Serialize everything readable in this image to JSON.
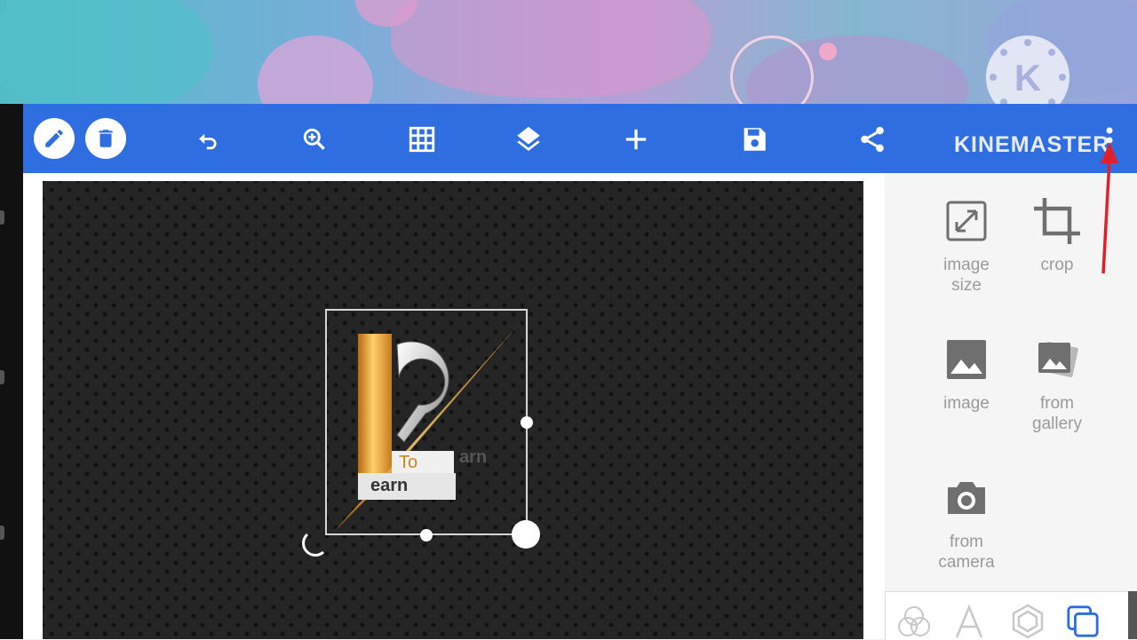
{
  "app": {
    "brand": "KINEMASTER"
  },
  "toolbar": {
    "items": [
      {
        "icon": "pencil-icon",
        "name": "edit"
      },
      {
        "icon": "trash-icon",
        "name": "delete"
      },
      {
        "icon": "undo-icon",
        "name": "undo"
      },
      {
        "icon": "zoom-in-icon",
        "name": "zoom"
      },
      {
        "icon": "grid-icon",
        "name": "grid"
      },
      {
        "icon": "layers-icon",
        "name": "layers"
      },
      {
        "icon": "plus-icon",
        "name": "add"
      },
      {
        "icon": "save-icon",
        "name": "save"
      },
      {
        "icon": "share-icon",
        "name": "share"
      },
      {
        "icon": "more-vertical-icon",
        "name": "more"
      }
    ]
  },
  "canvas": {
    "logo": {
      "letters": [
        "To",
        "arn",
        "earn"
      ]
    }
  },
  "side_panel": {
    "tools": [
      {
        "label_line1": "image",
        "label_line2": "size",
        "icon": "resize-icon"
      },
      {
        "label_line1": "crop",
        "label_line2": "",
        "icon": "crop-icon"
      },
      {
        "label_line1": "image",
        "label_line2": "",
        "icon": "image-icon"
      },
      {
        "label_line1": "from",
        "label_line2": "gallery",
        "icon": "gallery-icon"
      },
      {
        "label_line1": "from",
        "label_line2": "camera",
        "icon": "camera-icon"
      }
    ],
    "bottom_tabs": [
      "blend-icon",
      "text-icon",
      "shape-icon",
      "layers-copy-icon"
    ]
  },
  "colors": {
    "toolbar": "#2e6ee0",
    "canvas_bg": "#252525",
    "annotation_arrow": "#e0202a",
    "active_tab": "#2e6ee0"
  }
}
